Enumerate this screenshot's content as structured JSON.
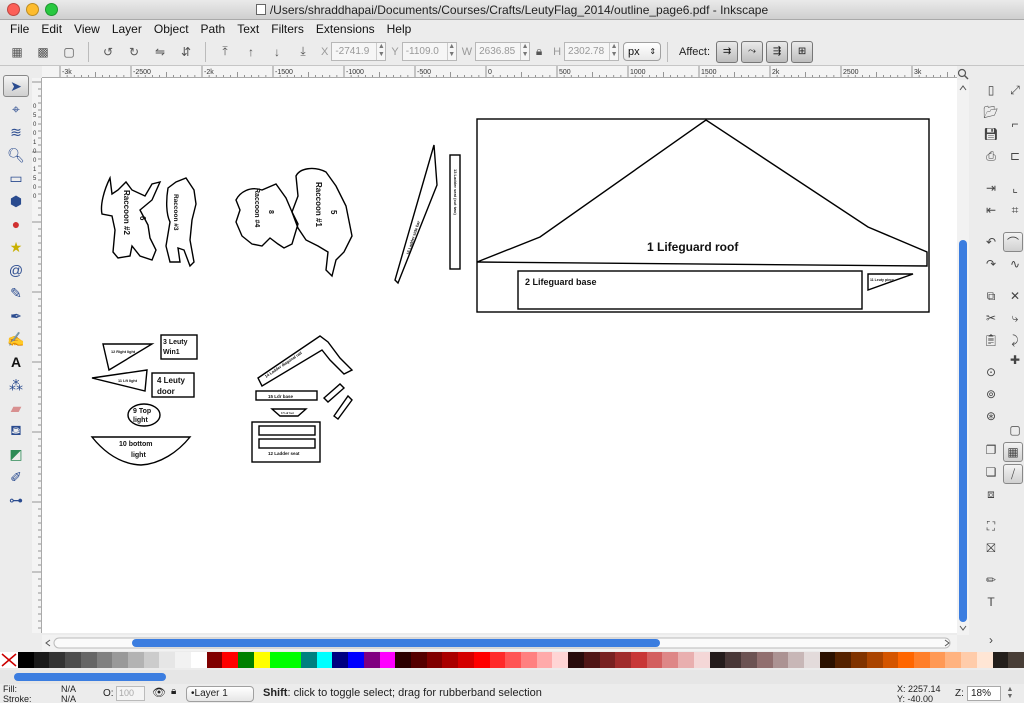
{
  "window": {
    "title": "/Users/shraddhapai/Documents/Courses/Crafts/LeutyFlag_2014/outline_page6.pdf - Inkscape"
  },
  "menu": [
    "File",
    "Edit",
    "View",
    "Layer",
    "Object",
    "Path",
    "Text",
    "Filters",
    "Extensions",
    "Help"
  ],
  "toolbar": {
    "x_label": "X",
    "x_value": "-2741.9",
    "y_label": "Y",
    "y_value": "-1109.0",
    "w_label": "W",
    "w_value": "2636.85",
    "h_label": "H",
    "h_value": "2302.78",
    "unit": "px",
    "affect_label": "Affect:"
  },
  "ruler": {
    "h_ticks": [
      "-3k",
      "-2500",
      "-2k",
      "-1500",
      "-1000",
      "-500",
      "0",
      "500",
      "1000",
      "1500",
      "2k",
      "2500",
      "3k"
    ],
    "v_ticks": [
      "0",
      "5",
      "0",
      "0",
      "1",
      "0",
      "0",
      "1",
      "5",
      "0",
      "0"
    ]
  },
  "canvas": {
    "labels": {
      "roof": "1 Lifeguard roof",
      "base": "2 Lifeguard base",
      "leuty_piece": "11 Leuty piece",
      "raccoon2": "Raccoon #2",
      "raccoon2_num": "6",
      "raccoon3": "Raccoon #3",
      "raccoon4": "Raccoon #4",
      "raccoon4_num": "8",
      "raccoon1": "Raccoon #1",
      "raccoon1_num": "5",
      "ladder_side": "16 Ladder side bar",
      "ladder_seat_cut": "13 Ladder seat (cut two)",
      "right_light": "12 Right light",
      "lt_light": "11 Lft light",
      "leuty_win1_a": "3 Leuty",
      "leuty_win1_b": "Win1",
      "leuty_door_a": "4 Leuty",
      "leuty_door_b": "door",
      "top_light_a": "9 Top",
      "top_light_b": "light",
      "bottom_light_a": "10 bottom",
      "bottom_light_b": "light",
      "ladder_diag": "14 Ladder diagonal rail",
      "ldr_base": "15 Ldr base",
      "small_piece": "17 Ldr foot",
      "ladder_seat": "12 Ladder seat"
    }
  },
  "status": {
    "fill_label": "Fill:",
    "fill_value": "N/A",
    "stroke_label": "Stroke:",
    "stroke_value": "N/A",
    "opacity_label": "O:",
    "opacity_value": "100",
    "layer": "•Layer 1",
    "message_bold": "Shift",
    "message": ": click to toggle select; drag for rubberband selection",
    "coord_x": "X: 2257.14",
    "coord_y": "Y:  -40.00",
    "zoom_label": "Z:",
    "zoom_value": "18%"
  },
  "colors": {
    "selected_tool": "#2a4b8f",
    "scrollbar": "#3b7de0"
  },
  "palette": [
    "#000000",
    "#1a1a1a",
    "#333333",
    "#4d4d4d",
    "#666666",
    "#808080",
    "#999999",
    "#b3b3b3",
    "#cccccc",
    "#e6e6e6",
    "#f2f2f2",
    "#ffffff",
    "#800000",
    "#ff0000",
    "#008000",
    "#ffff00",
    "#00ff00",
    "#00ff00",
    "#008080",
    "#00ffff",
    "#000080",
    "#0000ff",
    "#800080",
    "#ff00ff",
    "#2b0000",
    "#550000",
    "#800000",
    "#aa0000",
    "#d40000",
    "#ff0000",
    "#ff2a2a",
    "#ff5555",
    "#ff8080",
    "#ffaaaa",
    "#ffd5d5",
    "#280b0b",
    "#501616",
    "#782121",
    "#a02c2c",
    "#c83737",
    "#d35f5f",
    "#de8787",
    "#e9afaf",
    "#f4d7d7",
    "#241c1c",
    "#483737",
    "#6c5353",
    "#916f6f",
    "#ac9393",
    "#c8b7b7",
    "#e3dbdb",
    "#2b1100",
    "#552200",
    "#803300",
    "#aa4400",
    "#d45500",
    "#ff6600",
    "#ff7f2a",
    "#ff9955",
    "#ffb380",
    "#ffccaa",
    "#ffe6d5",
    "#241f1c",
    "#483e37"
  ]
}
